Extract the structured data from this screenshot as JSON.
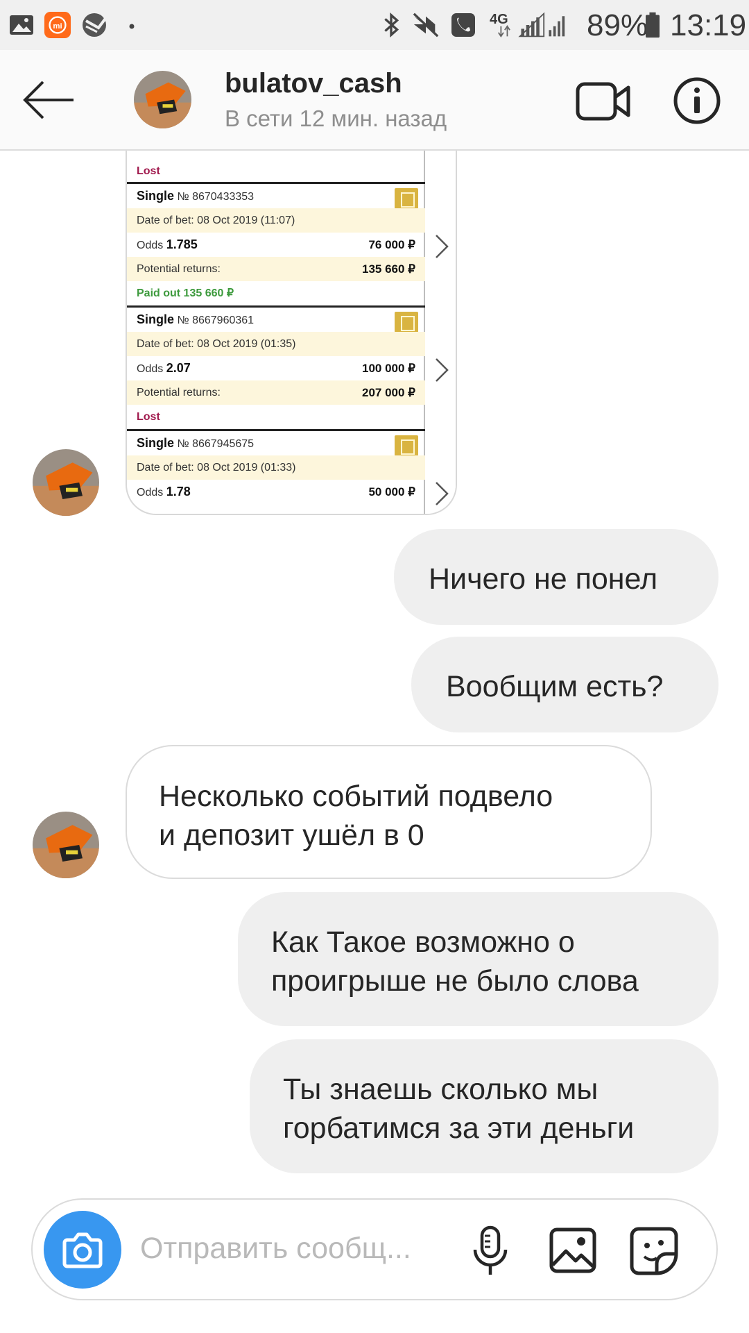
{
  "status_bar": {
    "network": "4G",
    "battery": "89%",
    "time": "13:19",
    "icons": [
      "gallery-icon",
      "mi-icon",
      "sber-icon",
      "dot-icon",
      "bluetooth-icon",
      "vibrate-icon",
      "call-icon",
      "signal-icon",
      "signal-icon",
      "battery-icon"
    ]
  },
  "header": {
    "username": "bulatov_cash",
    "status": "В сети 12 мин. назад",
    "icons": [
      "back-arrow-icon",
      "video-call-icon",
      "info-icon"
    ]
  },
  "bet_screenshot": {
    "top_partial": {
      "status": "Lost"
    },
    "cards": [
      {
        "type": "Single",
        "number": "№ 8670433353",
        "date_label": "Date of bet: 08 Oct 2019 (11:07)",
        "odds_label": "Odds",
        "odds": "1.785",
        "stake": "76 000 ₽",
        "returns_label": "Potential returns:",
        "returns": "135 660 ₽",
        "status": "Paid out 135 660 ₽"
      },
      {
        "type": "Single",
        "number": "№ 8667960361",
        "date_label": "Date of bet: 08 Oct 2019 (01:35)",
        "odds_label": "Odds",
        "odds": "2.07",
        "stake": "100 000 ₽",
        "returns_label": "Potential returns:",
        "returns": "207 000 ₽",
        "status": "Lost"
      },
      {
        "type": "Single",
        "number": "№ 8667945675",
        "date_label": "Date of bet: 08 Oct 2019 (01:33)",
        "odds_label": "Odds",
        "odds": "1.78",
        "stake": "50 000 ₽"
      }
    ]
  },
  "messages": [
    {
      "from": "me",
      "text": "Ничего не понел"
    },
    {
      "from": "me",
      "text": "Вообщим есть?"
    },
    {
      "from": "them",
      "text": "Несколько событий подвело\nи депозит ушёл в 0"
    },
    {
      "from": "me",
      "text": "Как Такое возможно о\nпроигрыше не было слова"
    },
    {
      "from": "me",
      "text": "Ты знаешь сколько мы\nгорбатимся за эти деньги"
    }
  ],
  "composer": {
    "placeholder": "Отправить сообщ...",
    "icons": [
      "camera-icon",
      "microphone-icon",
      "gallery-icon",
      "sticker-icon"
    ]
  },
  "colors": {
    "accent": "#3897f0",
    "bubble_out": "#efefef",
    "lost": "#a0184c",
    "paid": "#3d9a3d"
  }
}
